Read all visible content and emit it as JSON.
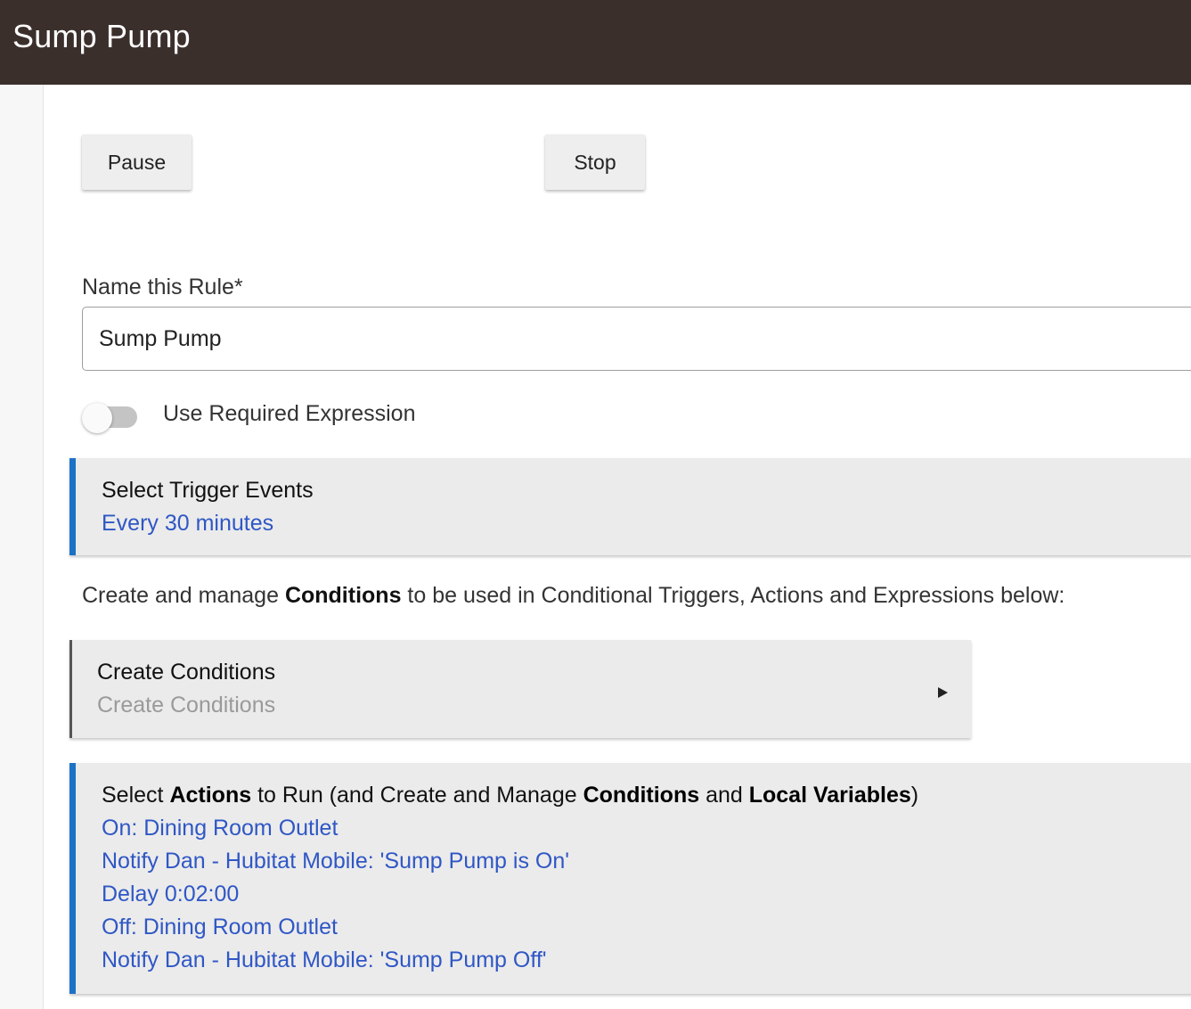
{
  "header": {
    "title": "Sump Pump"
  },
  "controls": {
    "pause_label": "Pause",
    "stop_label": "Stop"
  },
  "rule_name": {
    "label": "Name this Rule*",
    "value": "Sump Pump"
  },
  "required_expression": {
    "label": "Use Required Expression",
    "enabled": false
  },
  "trigger_panel": {
    "title": "Select Trigger Events",
    "summary": "Every 30 minutes"
  },
  "conditions_intro": {
    "prefix": "Create and manage ",
    "bold": "Conditions",
    "suffix": " to be used in Conditional Triggers, Actions and Expressions below:"
  },
  "create_conditions_panel": {
    "title": "Create Conditions",
    "subtitle": "Create Conditions"
  },
  "actions_panel": {
    "title_parts": {
      "t1": "Select ",
      "b1": "Actions",
      "t2": " to Run (and Create and Manage ",
      "b2": "Conditions",
      "t3": " and ",
      "b3": "Local Variables",
      "t4": ")"
    },
    "items": [
      "On: Dining Room Outlet",
      "Notify Dan - Hubitat Mobile: 'Sump Pump is On'",
      "Delay 0:02:00",
      "Off: Dining Room Outlet",
      "Notify Dan - Hubitat Mobile: 'Sump Pump Off'"
    ]
  },
  "colors": {
    "header_bg": "#3b2f2c",
    "link_blue": "#2f57c5",
    "accent_bar": "#1c72c5",
    "panel_bg": "#ebebeb"
  }
}
